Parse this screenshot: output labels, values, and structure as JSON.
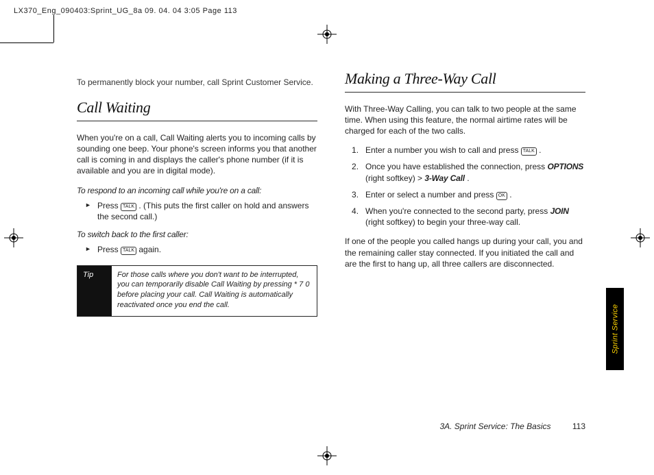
{
  "header": "LX370_Eng_090403:Sprint_UG_8a  09. 04. 04     3:05  Page 113",
  "left": {
    "intro": "To permanently block your number, call Sprint Customer Service.",
    "h1": "Call Waiting",
    "p1": "When you're on a call, Call Waiting alerts you to incoming calls by sounding one beep. Your phone's screen informs you that another call is coming in and displays the caller's phone number (if it is available and you are in digital mode).",
    "sub1": "To respond to an incoming call while you're on a call:",
    "li1a": "Press ",
    "li1b": " . (This puts the first caller on hold and answers the second call.)",
    "sub2": "To switch back to the first caller:",
    "li2a": "Press ",
    "li2b": "  again.",
    "tip_label": "Tip",
    "tip_body": "For those calls where you don't want to be interrupted, you can temporarily disable Call Waiting by pressing * 7 0 before placing your call. Call Waiting is automatically reactivated once you end the call."
  },
  "right": {
    "h1": "Making a Three-Way Call",
    "p1": "With Three-Way Calling, you can talk to two people at the same time. When using this feature, the normal airtime rates will be charged for each of the two calls.",
    "s1a": "Enter a number you wish to call and press  ",
    "s1b": "  .",
    "s2a": "Once you have established the connection, press ",
    "s2b": "OPTIONS",
    "s2c": " (right softkey) > ",
    "s2d": "3-Way Call",
    "s2e": ".",
    "s3a": "Enter or select a number and press  ",
    "s3b": " .",
    "s4a": "When you're connected to the second party, press ",
    "s4b": "JOIN",
    "s4c": " (right softkey) to begin your three-way call.",
    "p2": "If one of the people you called hangs up during your call, you and the remaining caller stay connected. If you initiated the call and are the first to hang up, all three callers are disconnected."
  },
  "keys": {
    "talk": "TALK",
    "ok": "OK"
  },
  "sidetab": "Sprint Service",
  "footer": {
    "section": "3A. Sprint Service: The Basics",
    "page": "113"
  }
}
